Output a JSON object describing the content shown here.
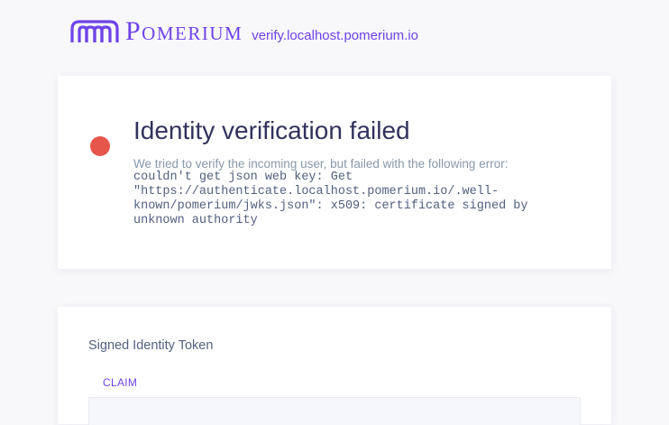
{
  "header": {
    "logo_text": "Pomerium",
    "domain": "verify.localhost.pomerium.io"
  },
  "error_card": {
    "title": "Identity verification failed",
    "description": "We tried to verify the incoming user, but failed with the following error:",
    "error_lines": [
      "couldn't get json web key: Get",
      "\"https://authenticate.localhost.pomerium.io/.well-",
      "known/pomerium/jwks.json\": x509: certificate signed by",
      "unknown authority"
    ],
    "status_color": "#e5574a"
  },
  "token_card": {
    "title": "Signed Identity Token",
    "table": {
      "columns": [
        "CLAIM"
      ]
    }
  },
  "colors": {
    "brand": "#6e43e8",
    "background": "#f8f8fb",
    "error": "#e5574a"
  }
}
